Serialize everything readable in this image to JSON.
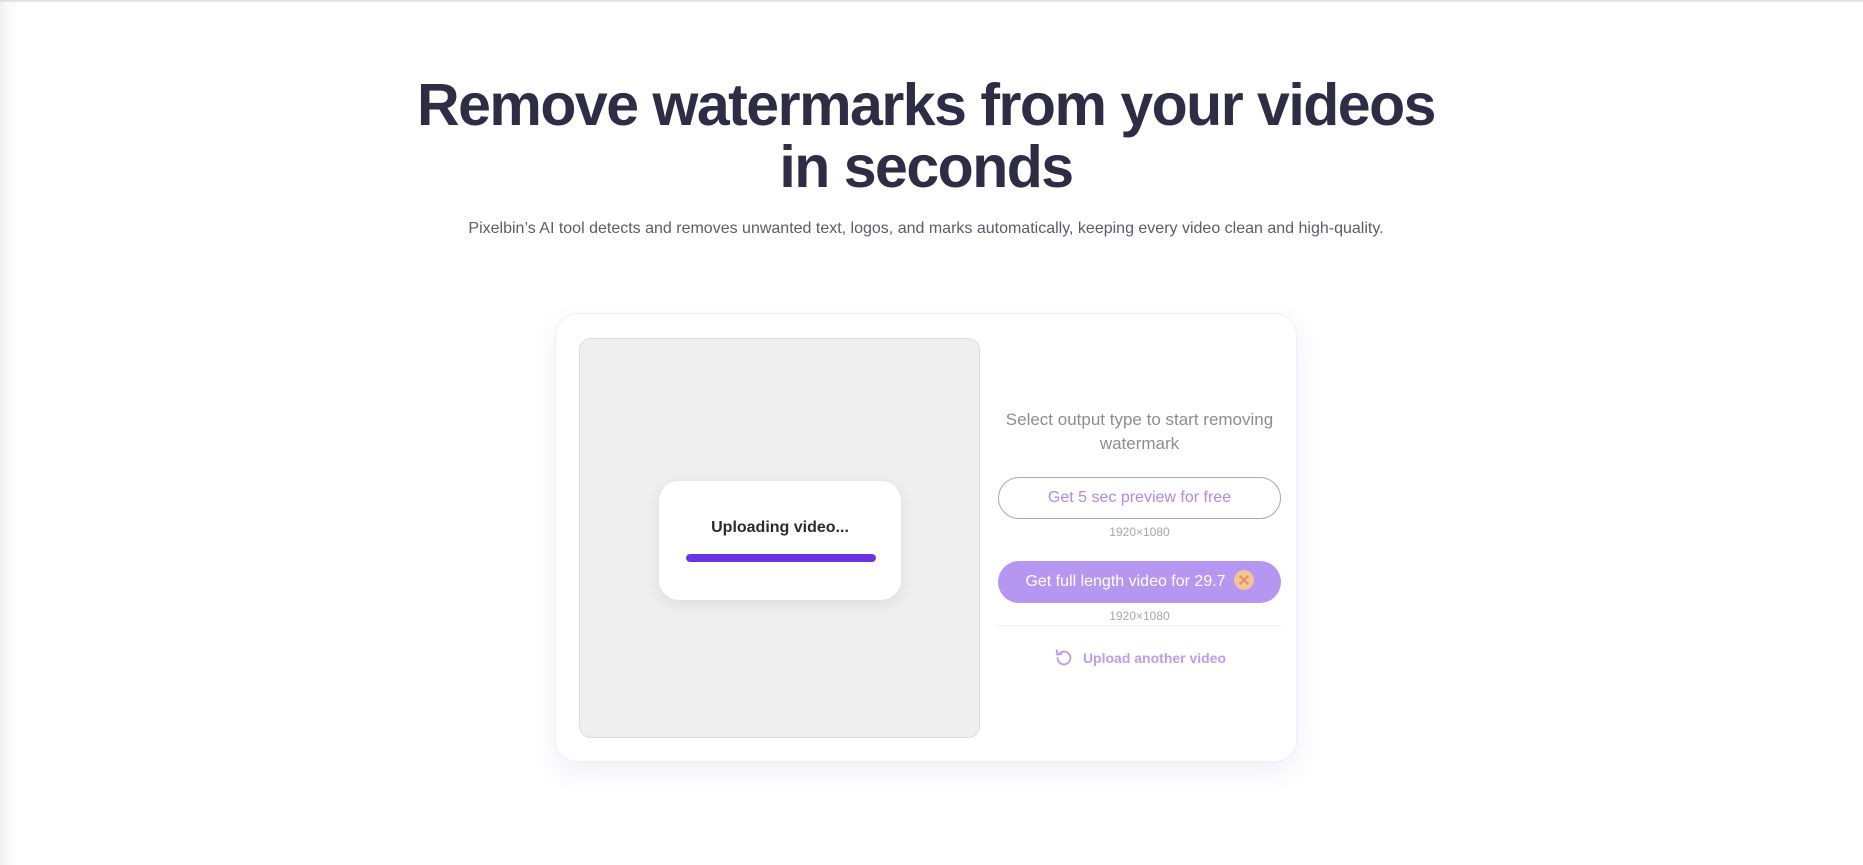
{
  "hero": {
    "title_line1": "Remove watermarks from your videos",
    "title_line2": "in seconds",
    "subtitle": "Pixelbin’s AI tool detects and removes unwanted text, logos, and marks automatically, keeping every video clean and high-quality."
  },
  "preview": {
    "status_text": "Uploading video...",
    "progress_percent": 100
  },
  "output": {
    "title": "Select output type to start removing watermark",
    "preview_button": "Get 5 sec preview for  free",
    "preview_resolution": "1920×1080",
    "full_button": "Get full length video for  29.7",
    "full_button_icon": "credit-coin-icon",
    "full_resolution": "1920×1080",
    "upload_another": "Upload another video",
    "upload_another_icon": "refresh-icon"
  },
  "colors": {
    "accent": "#6a34e6",
    "button_light": "#b597f1",
    "heading": "#2f2d45"
  }
}
